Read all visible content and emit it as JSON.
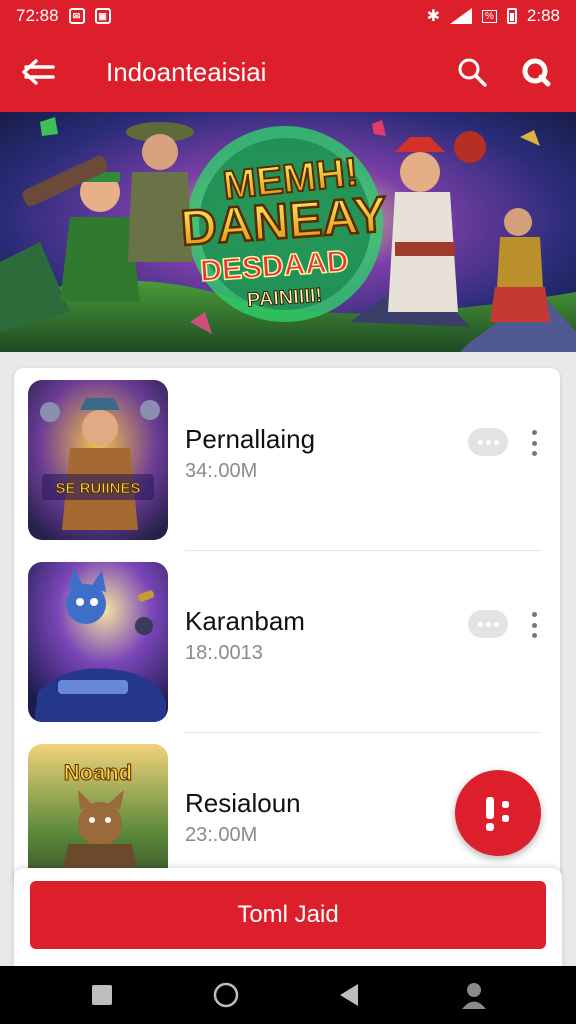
{
  "status_bar": {
    "time_left": "72:88",
    "time_right": "2:88"
  },
  "app_bar": {
    "title": "Indoanteaisiai"
  },
  "banner": {
    "line1": "MEMH!",
    "line2": "DANEAY",
    "line3": "DESDAAD",
    "line4": "PAINIIII!"
  },
  "items": [
    {
      "name": "Pernallaing",
      "size": "34:.00M"
    },
    {
      "name": "Karanbam",
      "size": "18:.0013"
    },
    {
      "name": "Resialoun",
      "size": "23:.00M"
    }
  ],
  "thumb_texts": {
    "item1": "SE RUIINES",
    "item3": "Noand"
  },
  "cta": {
    "label": "Toml Jaid"
  },
  "colors": {
    "brand": "#dc1f2b",
    "nav": "#000000"
  }
}
